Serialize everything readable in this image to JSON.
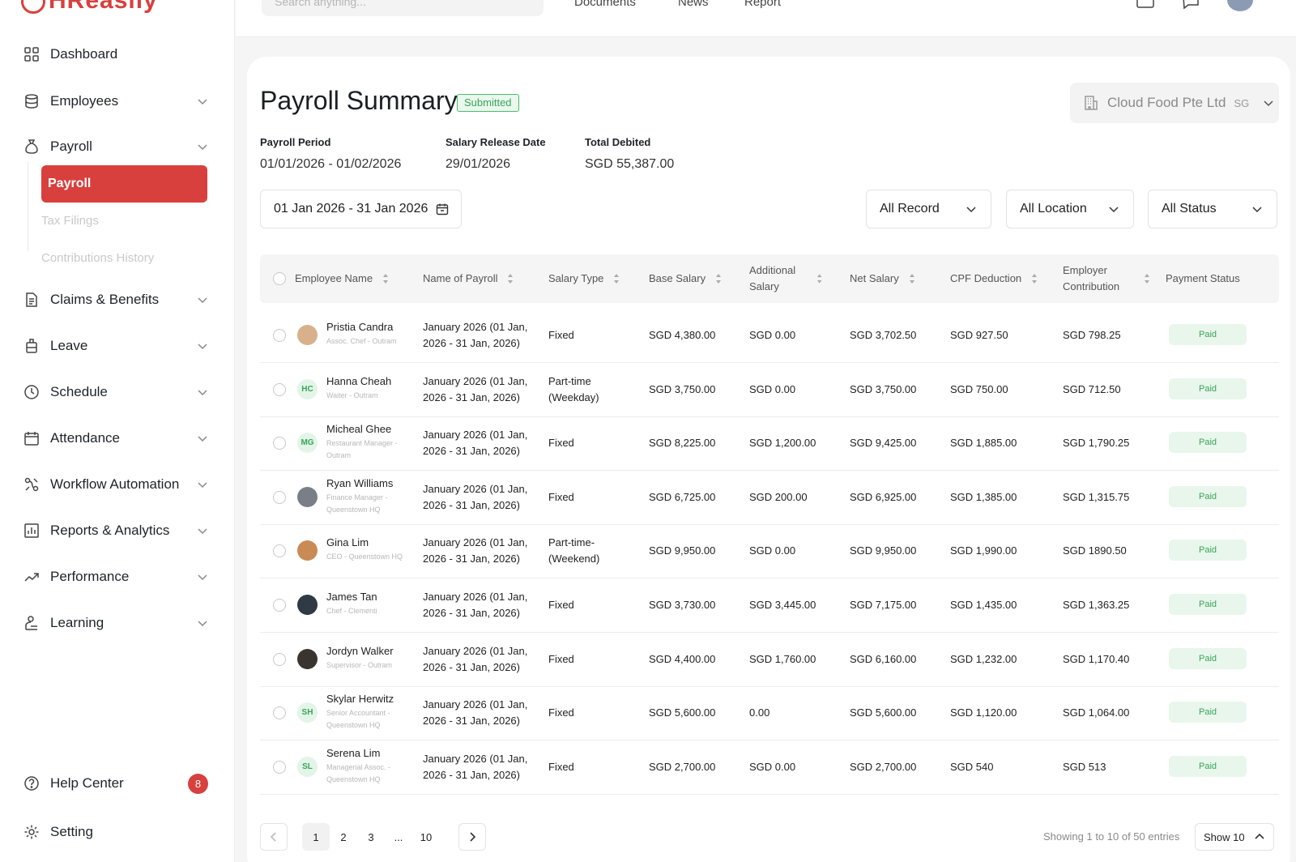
{
  "brand": {
    "logo_text": "HReasily",
    "accent": "#d8403d"
  },
  "topbar": {
    "search_placeholder": "Search anything...",
    "links": [
      "Documents",
      "News",
      "Report"
    ]
  },
  "sidebar": {
    "items": [
      {
        "label": "Dashboard",
        "icon": "grid-icon"
      },
      {
        "label": "Employees",
        "icon": "database-icon"
      },
      {
        "label": "Payroll",
        "icon": "money-bag-icon"
      },
      {
        "label": "Claims & Benefits",
        "icon": "document-icon"
      },
      {
        "label": "Leave",
        "icon": "luggage-icon"
      },
      {
        "label": "Schedule",
        "icon": "clock-icon"
      },
      {
        "label": "Attendance",
        "icon": "calendar-icon"
      },
      {
        "label": "Workflow Automation",
        "icon": "workflow-icon"
      },
      {
        "label": "Reports & Analytics",
        "icon": "bar-chart-icon"
      },
      {
        "label": "Performance",
        "icon": "trend-icon"
      },
      {
        "label": "Learning",
        "icon": "learning-icon"
      }
    ],
    "payroll_sub": [
      "Payroll",
      "Tax Filings",
      "Contributions History"
    ],
    "help_label": "Help Center",
    "help_count": "8",
    "setting_label": "Setting"
  },
  "page": {
    "title": "Payroll Summary",
    "status": "Submitted",
    "company": "Cloud Food Pte Ltd",
    "company_country": "SG",
    "payroll_period_label": "Payroll Period",
    "payroll_period": "01/01/2026 - 01/02/2026",
    "release_date_label": "Salary Release Date",
    "release_date": "29/01/2026",
    "total_debited_label": "Total Debited",
    "total_debited": "SGD 55,387.00",
    "date_range": "01 Jan 2026 - 31 Jan 2026",
    "filters": [
      "All Record",
      "All Location",
      "All Status"
    ]
  },
  "table": {
    "headers": [
      "Employee Name",
      "Name of Payroll",
      "Salary Type",
      "Base Salary",
      "Additional Salary",
      "Net Salary",
      "CPF Deduction",
      "Employer Contribution",
      "Payment Status"
    ],
    "rows": [
      {
        "name": "Pristia Candra",
        "role": "Assoc. Chef - Outram",
        "initials": "",
        "avatar_color": "#d9b08c",
        "payroll": "January 2026 (01 Jan, 2026 - 31 Jan, 2026)",
        "type": "Fixed",
        "base": "SGD 4,380.00",
        "additional": "SGD 0.00",
        "net": "SGD 3,702.50",
        "cpf": "SGD 927.50",
        "employer": "SGD 798.25",
        "status": "Paid"
      },
      {
        "name": "Hanna Cheah",
        "role": "Waiter - Outram",
        "initials": "HC",
        "avatar_color": "",
        "payroll": "January 2026 (01 Jan, 2026 - 31 Jan, 2026)",
        "type": "Part-time (Weekday)",
        "base": "SGD 3,750.00",
        "additional": "SGD 0.00",
        "net": "SGD 3,750.00",
        "cpf": "SGD 750.00",
        "employer": "SGD 712.50",
        "status": "Paid"
      },
      {
        "name": "Micheal Ghee",
        "role": "Restaurant Manager - Outram",
        "initials": "MG",
        "avatar_color": "",
        "payroll": "January 2026 (01 Jan, 2026 - 31 Jan, 2026)",
        "type": "Fixed",
        "base": "SGD 8,225.00",
        "additional": "SGD 1,200.00",
        "net": "SGD 9,425.00",
        "cpf": "SGD 1,885.00",
        "employer": "SGD 1,790.25",
        "status": "Paid"
      },
      {
        "name": "Ryan Williams",
        "role": "Finance Manager - Queenstown HQ",
        "initials": "",
        "avatar_color": "#7a7f87",
        "payroll": "January 2026 (01 Jan, 2026 - 31 Jan, 2026)",
        "type": "Fixed",
        "base": "SGD 6,725.00",
        "additional": "SGD 200.00",
        "net": "SGD 6,925.00",
        "cpf": "SGD 1,385.00",
        "employer": "SGD 1,315.75",
        "status": "Paid"
      },
      {
        "name": "Gina Lim",
        "role": "CEO - Queenstown HQ",
        "initials": "",
        "avatar_color": "#c98a55",
        "payroll": "January 2026 (01 Jan, 2026 - 31 Jan, 2026)",
        "type": "Part-time- (Weekend)",
        "base": "SGD 9,950.00",
        "additional": "SGD 0.00",
        "net": "SGD 9,950.00",
        "cpf": "SGD 1,990.00",
        "employer": "SGD 1890.50",
        "status": "Paid"
      },
      {
        "name": "James Tan",
        "role": "Chef - Clementi",
        "initials": "",
        "avatar_color": "#2f3a44",
        "payroll": "January 2026 (01 Jan, 2026 - 31 Jan, 2026)",
        "type": "Fixed",
        "base": "SGD 3,730.00",
        "additional": "SGD 3,445.00",
        "net": "SGD 7,175.00",
        "cpf": "SGD 1,435.00",
        "employer": "SGD 1,363.25",
        "status": "Paid"
      },
      {
        "name": "Jordyn Walker",
        "role": "Supervisor - Outram",
        "initials": "",
        "avatar_color": "#3a3430",
        "payroll": "January 2026 (01 Jan, 2026 - 31 Jan, 2026)",
        "type": "Fixed",
        "base": "SGD 4,400.00",
        "additional": "SGD 1,760.00",
        "net": "SGD 6,160.00",
        "cpf": "SGD 1,232.00",
        "employer": "SGD 1,170.40",
        "status": "Paid"
      },
      {
        "name": "Skylar Herwitz",
        "role": "Senior Accountant - Queenstown HQ",
        "initials": "SH",
        "avatar_color": "",
        "payroll": "January 2026 (01 Jan, 2026 - 31 Jan, 2026)",
        "type": "Fixed",
        "base": "SGD 5,600.00",
        "additional": "0.00",
        "net": "SGD 5,600.00",
        "cpf": "SGD 1,120.00",
        "employer": "SGD 1,064.00",
        "status": "Paid"
      },
      {
        "name": "Serena Lim",
        "role": "Managerial Assoc. - Queenstown HQ",
        "initials": "SL",
        "avatar_color": "",
        "payroll": "January 2026 (01 Jan, 2026 - 31 Jan, 2026)",
        "type": "Fixed",
        "base": "SGD 2,700.00",
        "additional": "SGD 0.00",
        "net": "SGD 2,700.00",
        "cpf": "SGD 540",
        "employer": "SGD 513",
        "status": "Paid"
      }
    ]
  },
  "pagination": {
    "pages": [
      "1",
      "2",
      "3",
      "...",
      "10"
    ],
    "current": "1",
    "info": "Showing 1 to 10 of 50 entries",
    "show": "Show 10"
  }
}
